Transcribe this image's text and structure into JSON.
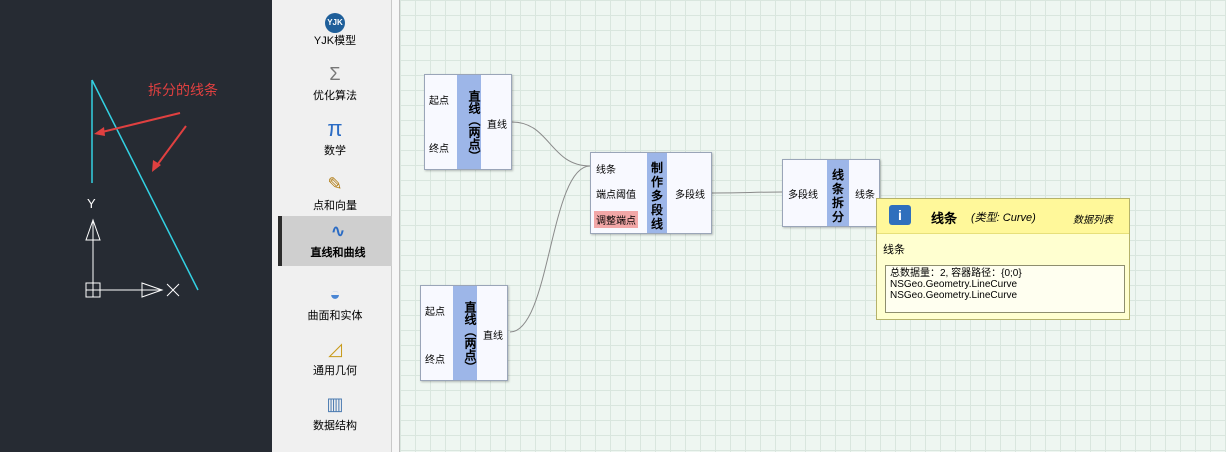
{
  "viewport": {
    "annotation": "拆分的线条",
    "axis_y_label": "Y",
    "colors": {
      "background": "#262b33",
      "line": "#33d1e3",
      "annotation": "#e04040",
      "axes": "#ffffff"
    }
  },
  "toolbox": {
    "items": [
      {
        "label": "YJK模型",
        "icon": "yjk-logo-icon",
        "glyph": "YJK"
      },
      {
        "label": "优化算法",
        "icon": "sigma-icon",
        "glyph": "Σ"
      },
      {
        "label": "数学",
        "icon": "pi-icon",
        "glyph": "π"
      },
      {
        "label": "点和向量",
        "icon": "point-vector-icon",
        "glyph": "✎"
      },
      {
        "label": "直线和曲线",
        "icon": "curve-icon",
        "glyph": "∿",
        "active": true
      },
      {
        "label": "曲面和实体",
        "icon": "surface-solid-icon",
        "glyph": "◒"
      },
      {
        "label": "通用几何",
        "icon": "geometry-icon",
        "glyph": "◿"
      },
      {
        "label": "数据结构",
        "icon": "data-structure-icon",
        "glyph": "▥"
      }
    ]
  },
  "canvas": {
    "nodes": {
      "line1": {
        "title": "直线（两点）",
        "in1": "起点",
        "in2": "终点",
        "out": "直线"
      },
      "line2": {
        "title": "直线（两点）",
        "in1": "起点",
        "in2": "终点",
        "out": "直线"
      },
      "polyline": {
        "title": "制作多段线",
        "in1": "线条",
        "in2": "端点阈值",
        "in3": "调整端点",
        "out": "多段线"
      },
      "split": {
        "title": "线条拆分",
        "in1": "多段线",
        "out": "线条"
      }
    },
    "tooltip": {
      "title": "线条",
      "type": "(类型:  Curve)",
      "list_label": "数据列表",
      "description": "线条",
      "summary": "总数据量：2, 容器路径：{0;0}",
      "items": [
        "NSGeo.Geometry.LineCurve",
        "NSGeo.Geometry.LineCurve"
      ]
    }
  }
}
